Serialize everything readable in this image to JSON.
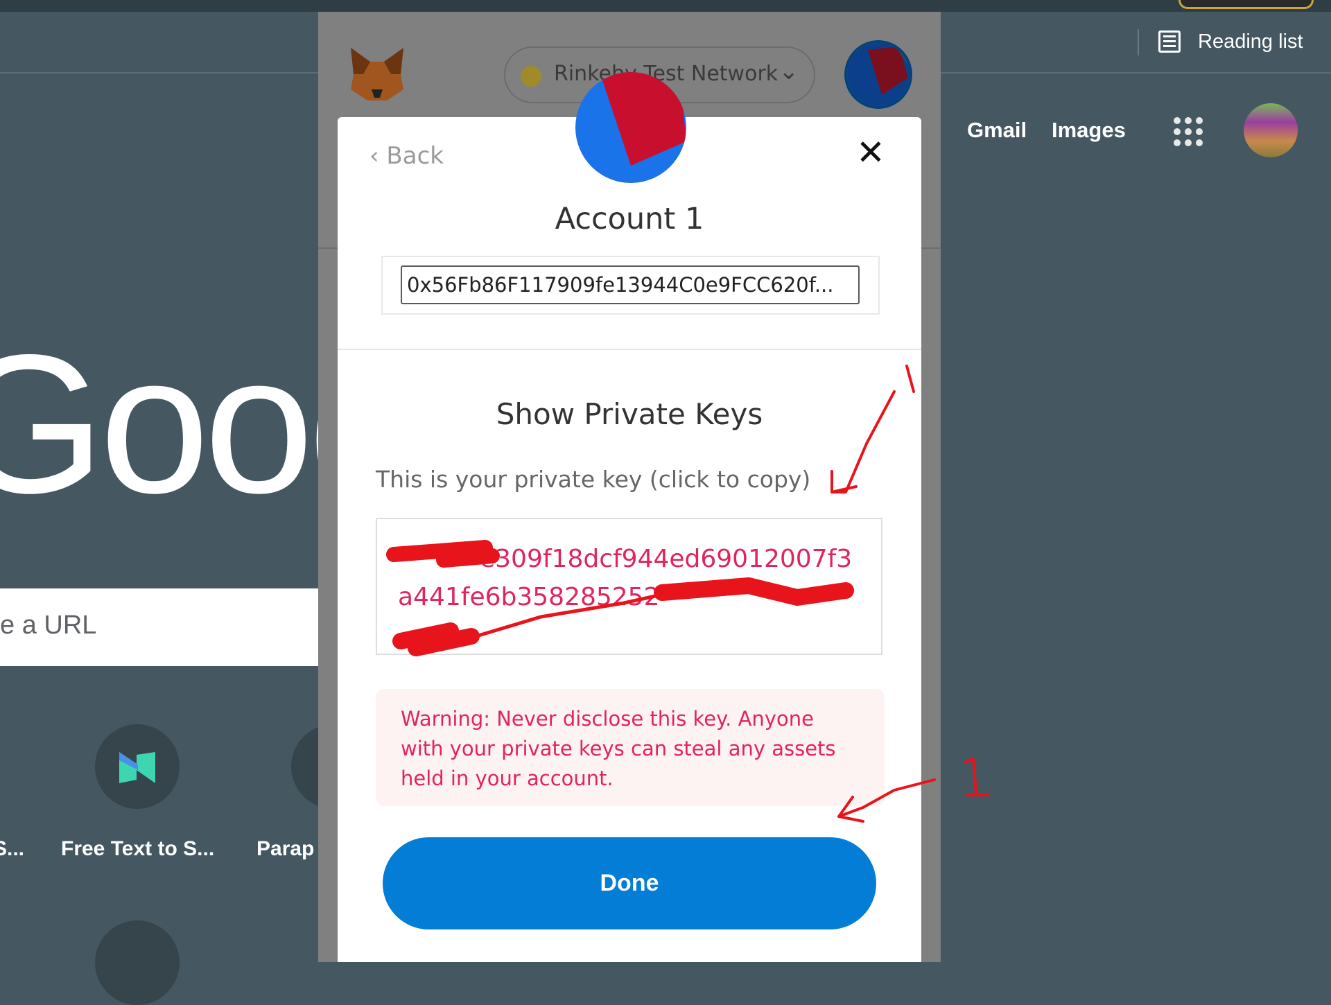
{
  "browser": {
    "reading_list": "Reading list",
    "links": {
      "gmail": "Gmail",
      "images": "Images"
    },
    "google_logo": "Google",
    "search_placeholder_visible": "e a URL",
    "shortcuts": [
      {
        "label": "S..."
      },
      {
        "label": "Free Text to S..."
      },
      {
        "label": "Parap"
      }
    ]
  },
  "metamask": {
    "network": "Rinkeby Test Network",
    "network_dot_color": "#a08a2a",
    "modal": {
      "back_label": "Back",
      "close_icon": "close-icon",
      "account_name": "Account 1",
      "address": "0x56Fb86F117909fe13944C0e9FCC620f...",
      "section_title": "Show Private Keys",
      "hint": "This is your private key (click to copy)",
      "private_key_visible": {
        "line1": "e309f18dcf944ed69012007f3",
        "line2": "a441fe6b358285252"
      },
      "warning": "Warning: Never disclose this key. Anyone with your private keys can steal any assets held in your account.",
      "done_label": "Done"
    },
    "colors": {
      "primary": "#037dd6",
      "danger": "#e0245e",
      "warning_bg": "#fdf3f3"
    }
  },
  "annotations": {
    "marks": [
      "1",
      "1"
    ],
    "color": "#e8141c"
  }
}
